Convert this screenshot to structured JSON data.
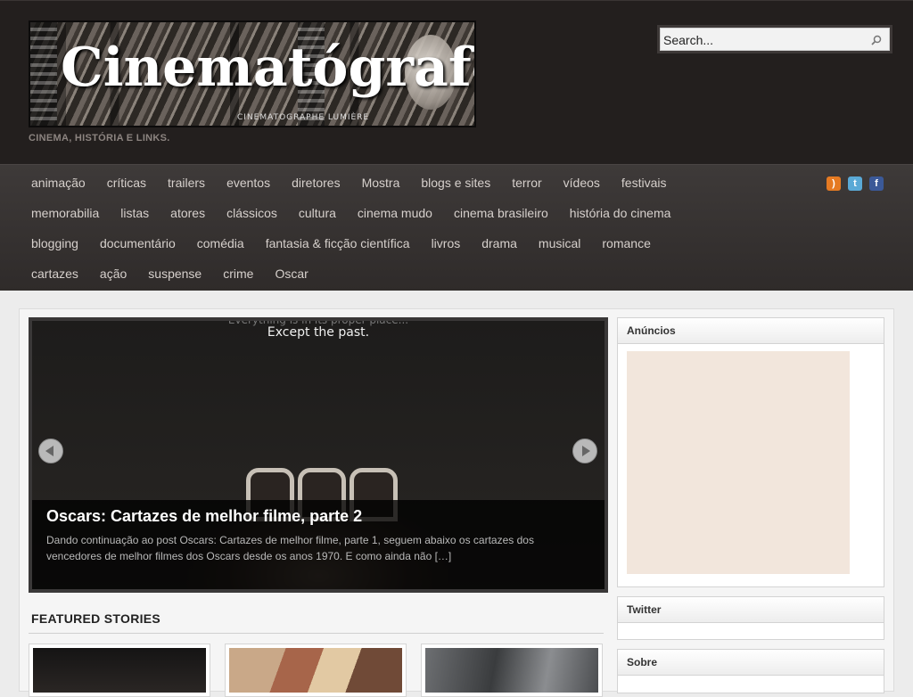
{
  "header": {
    "logo_title": "Cinematógrafo",
    "logo_caption": "CINEMATOGRAPHE LUMIÈRE",
    "tagline": "CINEMA, HISTÓRIA E LINKS.",
    "search_placeholder": "Search..."
  },
  "nav": {
    "rows": [
      [
        "animação",
        "críticas",
        "trailers",
        "eventos",
        "diretores",
        "Mostra",
        "blogs e sites",
        "terror",
        "vídeos",
        "festivais"
      ],
      [
        "memorabilia",
        "listas",
        "atores",
        "clássicos",
        "cultura",
        "cinema mudo",
        "cinema brasileiro",
        "história do cinema"
      ],
      [
        "blogging",
        "documentário",
        "comédia",
        "fantasia & ficção científica",
        "livros",
        "drama",
        "musical",
        "romance"
      ],
      [
        "cartazes",
        "ação",
        "suspense",
        "crime",
        "Oscar"
      ]
    ],
    "social": [
      "rss-icon",
      "twitter-icon",
      "facebook-icon"
    ]
  },
  "slider": {
    "poster_text": "Except the past.",
    "poster_text_top": "Everything is in its proper place...",
    "title": "Oscars: Cartazes de melhor filme, parte 2",
    "excerpt": "Dando continuação ao post Oscars: Cartazes de melhor filme, parte 1, seguem abaixo os cartazes dos vencedores de melhor filmes dos Oscars desde os anos 1970. E como ainda não […]"
  },
  "featured": {
    "title": "FEATURED STORIES"
  },
  "sidebar": {
    "ads_title": "Anúncios",
    "twitter_title": "Twitter",
    "about_title": "Sobre"
  },
  "colors": {
    "header_bg": "#231f1e",
    "nav_bg": "#3a3635",
    "ad_bg": "#f2e6dc"
  }
}
